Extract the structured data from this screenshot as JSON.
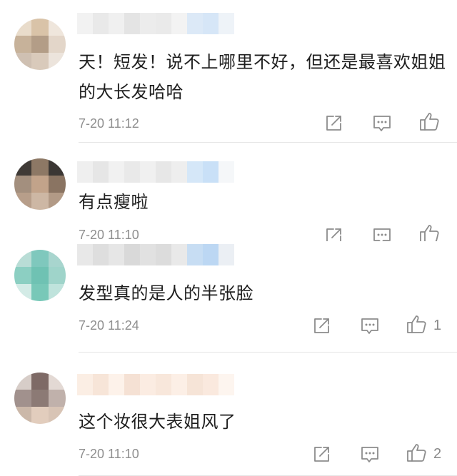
{
  "icons": {
    "share": "share-icon",
    "reply": "reply-icon",
    "like": "thumbs-up-icon"
  },
  "comments": [
    {
      "text": "天！短发！说不上哪里不好，但还是最喜欢姐姐的大长发哈哈",
      "time": "7-20 11:12",
      "likes": "",
      "avatar_colors": [
        "#e9dccb",
        "#d9c3a8",
        "#efe6dc",
        "#c7b29a",
        "#b39d87",
        "#e3d6c9",
        "#cfc0b2",
        "#d9cabb",
        "#ece4dc"
      ],
      "name_colors": [
        "#f2f2f2",
        "#e9e9e9",
        "#f0f0f0",
        "#e4e4e4",
        "#ececec",
        "#eaeaea",
        "#f3f3f3",
        "#dce9f7",
        "#d6e6f7",
        "#eef3f8"
      ]
    },
    {
      "text": "有点瘦啦",
      "time": "7-20 11:10",
      "likes": "",
      "avatar_colors": [
        "#3f3a36",
        "#8d7865",
        "#3b3734",
        "#a38f7e",
        "#c2a38a",
        "#8a7462",
        "#b79e8a",
        "#cdb7a4",
        "#b29a86"
      ],
      "name_colors": [
        "#efefef",
        "#e6e6e6",
        "#f1f1f1",
        "#e9e9e9",
        "#f0f0f0",
        "#e7e7e7",
        "#eeeeee",
        "#d5e7f8",
        "#c9e0f7",
        "#f5f7f9"
      ]
    },
    {
      "text": "发型真的是人的半张脸",
      "time": "7-20 11:24",
      "likes": "1",
      "avatar_colors": [
        "#b9ddd6",
        "#7fc8bd",
        "#a8d5ce",
        "#8ccfc2",
        "#6fc2b3",
        "#9fd4ca",
        "#d3ebe6",
        "#78c8b8",
        "#bfe3dc"
      ],
      "name_colors": [
        "#e8e8e8",
        "#dedede",
        "#e6e6e6",
        "#d9d9d9",
        "#e1e1e1",
        "#dcdcdc",
        "#e9e9e9",
        "#c7ddf3",
        "#bcd7f3",
        "#ebeff4"
      ]
    },
    {
      "text": "这个妆很大表姐风了",
      "time": "7-20 11:10",
      "likes": "2",
      "avatar_colors": [
        "#d7cdc8",
        "#7e6a66",
        "#e3d9d4",
        "#a1918d",
        "#8c7a75",
        "#c0b1ab",
        "#cbb8a9",
        "#e2cdbd",
        "#d8c4b5"
      ],
      "name_colors": [
        "#fbeee4",
        "#f7e5d8",
        "#fdf2ea",
        "#f5e1d4",
        "#fbece2",
        "#f8e7db",
        "#fcefe6",
        "#f6e4d7",
        "#fae9de",
        "#fdf5ef"
      ]
    }
  ]
}
